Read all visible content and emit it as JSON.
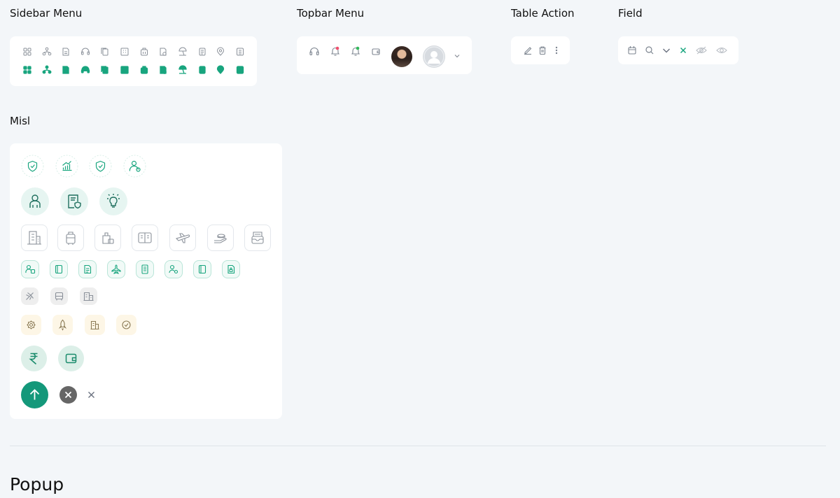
{
  "sections": {
    "sidebar_menu": "Sidebar Menu",
    "topbar_menu": "Topbar Menu",
    "table_action": "Table Action",
    "field": "Field",
    "misl": "Misl",
    "popup": "Popup"
  },
  "colors": {
    "accent": "#18a57e",
    "accent_light": "#e6f5f1",
    "icon_grey": "#7d8590",
    "bell_red": "#f0506e",
    "bell_green": "#33b85c",
    "yellow_bg": "#fdf6e6",
    "grey_bg": "#eeeeee",
    "close_dark": "#666666"
  },
  "sidebar_icons": [
    "dashboard-icon",
    "org-chart-icon",
    "document-icon",
    "headset-icon",
    "copy-document-icon",
    "building-icon",
    "luggage-icon",
    "policy-document-icon",
    "beach-umbrella-icon",
    "receipt-icon",
    "location-pin-icon",
    "list-document-icon"
  ],
  "topbar_icons": [
    "headset-icon",
    "bell-icon",
    "bell-icon",
    "wallet-icon",
    "profile-photo",
    "default-avatar",
    "chevron-down-icon"
  ],
  "table_action_icons": [
    "edit-icon",
    "delete-icon",
    "more-vertical-icon"
  ],
  "field_icons": [
    "calendar-icon",
    "search-icon",
    "chevron-down-icon",
    "clear-icon",
    "eye-off-icon",
    "eye-icon"
  ],
  "misl_rows": {
    "row1": [
      "shield-check-icon",
      "chart-growth-icon",
      "shield-check-icon",
      "user-settings-icon"
    ],
    "row2": [
      "user-icon",
      "document-shield-icon",
      "idea-icon"
    ],
    "row3": [
      "building-icon",
      "luggage-icon",
      "bag-icon",
      "book-icon",
      "airplane-icon",
      "hand-coins-icon",
      "mail-box-icon"
    ],
    "row4": [
      "user-card-icon",
      "book-icon",
      "document-icon",
      "airplane-icon",
      "receipt-icon",
      "user-settings-icon",
      "book-icon",
      "document-lock-icon"
    ],
    "row5": [
      "airplane-icon",
      "bus-icon",
      "building-icon"
    ],
    "row6": [
      "gear-icon",
      "rocket-icon",
      "building-icon",
      "check-circle-icon"
    ],
    "row7": [
      "rupee-icon",
      "wallet-icon"
    ],
    "row8": [
      "arrow-up-icon",
      "close-circle-icon",
      "close-icon"
    ]
  }
}
